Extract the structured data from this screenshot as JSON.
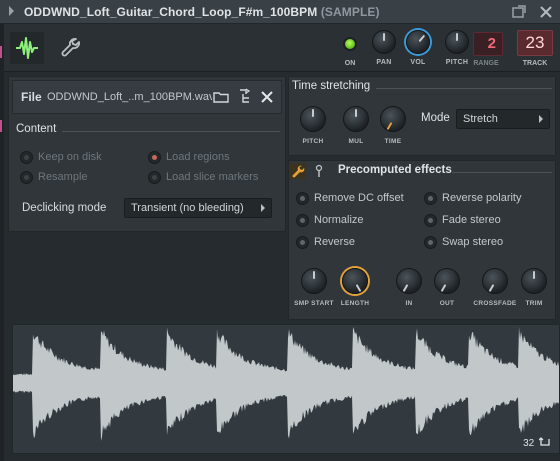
{
  "window": {
    "title": "ODDWND_Loft_Guitar_Chord_Loop_F#m_100BPM",
    "title_suffix": "(SAMPLE)"
  },
  "toolbar": {
    "on_label": "ON",
    "pan_label": "PAN",
    "vol_label": "VOL",
    "pitch_label": "PITCH",
    "range_label": "RANGE",
    "range_value": "2",
    "track_label": "TRACK",
    "track_value": "23"
  },
  "file": {
    "label": "File",
    "name": "ODDWND_Loft_..m_100BPM.wav"
  },
  "content": {
    "title": "Content",
    "keep_on_disk": "Keep on disk",
    "load_regions": "Load regions",
    "resample": "Resample",
    "load_slice_markers": "Load slice markers",
    "declicking_label": "Declicking mode",
    "declicking_value": "Transient (no bleeding)"
  },
  "time_stretching": {
    "title": "Time stretching",
    "pitch_label": "PITCH",
    "mul_label": "MUL",
    "time_label": "TIME",
    "mode_label": "Mode",
    "mode_value": "Stretch"
  },
  "effects": {
    "title": "Precomputed effects",
    "remove_dc": "Remove DC offset",
    "reverse_polarity": "Reverse polarity",
    "normalize": "Normalize",
    "fade_stereo": "Fade stereo",
    "reverse": "Reverse",
    "swap_stereo": "Swap stereo",
    "knobs": [
      "SMP START",
      "LENGTH",
      "IN",
      "OUT",
      "CROSSFADE",
      "TRIM"
    ]
  },
  "waveform": {
    "footer_value": "32"
  },
  "colors": {
    "accent_orange": "#e3a13a",
    "on_green": "#7fe02a",
    "vol_blue": "#3c9bd6",
    "track_red": "#5b2a2f",
    "waveform": "#c2c7ca"
  }
}
